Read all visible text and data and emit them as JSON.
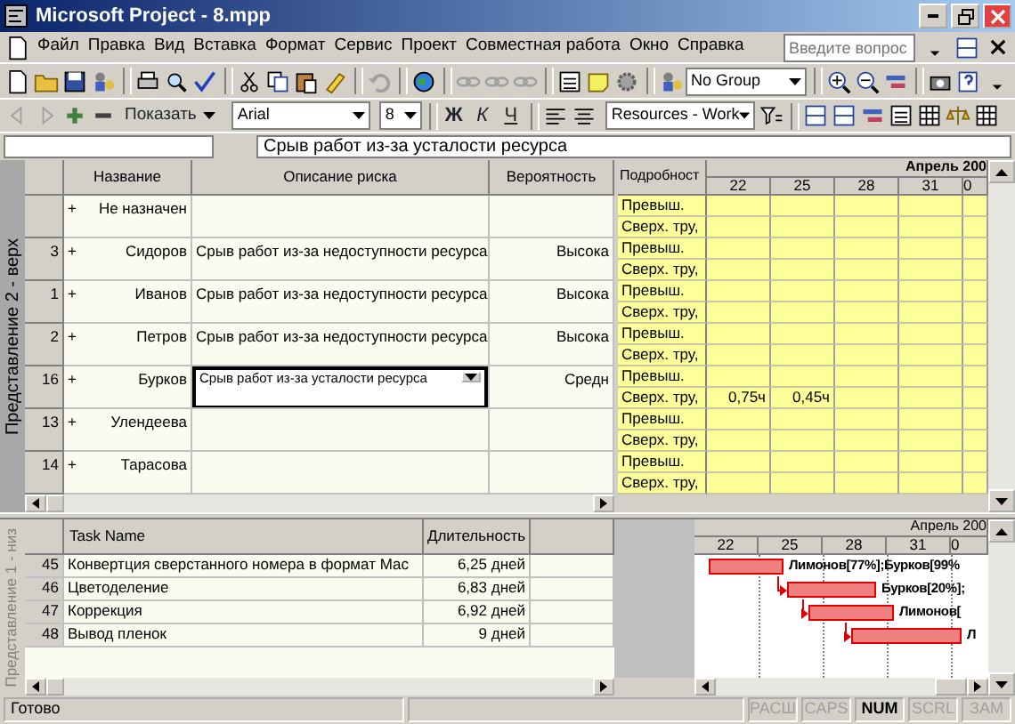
{
  "window": {
    "title": "Microsoft Project - 8.mpp"
  },
  "menu": [
    "Файл",
    "Правка",
    "Вид",
    "Вставка",
    "Формат",
    "Сервис",
    "Проект",
    "Совместная работа",
    "Окно",
    "Справка"
  ],
  "help_box": {
    "placeholder": "Введите вопрос"
  },
  "standard_toolbar": {
    "group_combo": "No Group"
  },
  "format_toolbar": {
    "show_button": "Показать",
    "font": "Arial",
    "size": "8",
    "styles": [
      "Ж",
      "К",
      "Ч"
    ],
    "filter_combo": "Resources - Work"
  },
  "entry_bar": {
    "value": "Срыв работ из-за усталости ресурса"
  },
  "upper_view": {
    "label": "Представление 2 - верх",
    "columns": [
      "Название",
      "Описание риска",
      "Вероятность"
    ],
    "detail_header": "Подробност",
    "month": "Апрель 200",
    "days": [
      "22",
      "25",
      "28",
      "31",
      "0"
    ],
    "rows": [
      {
        "expander": "+",
        "name": "Не назначен",
        "editing": false,
        "details": [
          {
            "label": "Превыш."
          },
          {
            "label": "Сверх. тру,"
          }
        ]
      },
      {
        "id": "3",
        "expander": "+",
        "name": "Сидоров",
        "risk": "Срыв работ из-за недоступности ресурса",
        "probability": "Высока",
        "editing": false,
        "details": [
          {
            "label": "Превыш."
          },
          {
            "label": "Сверх. тру,"
          }
        ]
      },
      {
        "id": "1",
        "expander": "+",
        "name": "Иванов",
        "risk": "Срыв работ из-за недоступности ресурса",
        "probability": "Высока",
        "editing": false,
        "details": [
          {
            "label": "Превыш."
          },
          {
            "label": "Сверх. тру,"
          }
        ]
      },
      {
        "id": "2",
        "expander": "+",
        "name": "Петров",
        "risk": "Срыв работ из-за недоступности ресурса",
        "probability": "Высока",
        "editing": false,
        "details": [
          {
            "label": "Превыш."
          },
          {
            "label": "Сверх. тру,"
          }
        ]
      },
      {
        "id": "16",
        "expander": "+",
        "name": "Бурков",
        "risk": "Срыв работ из-за усталости ресурса",
        "probability": "Средн",
        "editing": true,
        "details": [
          {
            "label": "Превыш."
          },
          {
            "label": "Сверх. тру,",
            "values": [
              "0,75ч",
              "0,45ч"
            ]
          }
        ]
      },
      {
        "id": "13",
        "expander": "+",
        "name": "Улендеева",
        "editing": false,
        "details": [
          {
            "label": "Превыш."
          },
          {
            "label": "Сверх. тру,"
          }
        ]
      },
      {
        "id": "14",
        "expander": "+",
        "name": "Тарасова",
        "editing": false,
        "details": [
          {
            "label": "Превыш."
          },
          {
            "label": "Сверх. тру,"
          }
        ]
      }
    ]
  },
  "lower_view": {
    "label": "Представление 1 - низ",
    "columns": [
      "Task Name",
      "Длительность"
    ],
    "month": "Апрель 200",
    "days": [
      "22",
      "25",
      "28",
      "31",
      "0"
    ],
    "rows": [
      {
        "id": "45",
        "name": "Конвертция сверстанного номера в формат Мас",
        "duration": "6,25 дней",
        "bar_label": "Лимонов[77%];Бурков[99%"
      },
      {
        "id": "46",
        "name": "Цветоделение",
        "duration": "6,83 дней",
        "bar_label": "Бурков[20%];"
      },
      {
        "id": "47",
        "name": "Коррекция",
        "duration": "6,92 дней",
        "bar_label": "Лимонов["
      },
      {
        "id": "48",
        "name": "Вывод пленок",
        "duration": "9 дней",
        "bar_label": "Л"
      }
    ]
  },
  "status_bar": {
    "text": "Готово",
    "indicators": [
      {
        "label": "РАСШ",
        "on": false
      },
      {
        "label": "CAPS",
        "on": false
      },
      {
        "label": "NUM",
        "on": true
      },
      {
        "label": "SCRL",
        "on": false
      },
      {
        "label": "ЗАМ",
        "on": false
      }
    ]
  }
}
